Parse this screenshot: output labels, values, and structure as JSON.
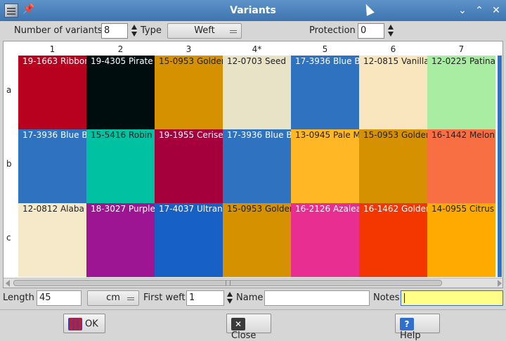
{
  "window": {
    "title": "Variants"
  },
  "toolbar": {
    "num_variants_label": "Number of variants",
    "num_variants_value": "8",
    "type_label": "Type",
    "type_value": "Weft",
    "protection_label": "Protection",
    "protection_value": "0"
  },
  "grid": {
    "columns": [
      "1",
      "2",
      "3",
      "4*",
      "5",
      "6",
      "7"
    ],
    "rows": [
      "a",
      "b",
      "c"
    ],
    "cells": [
      [
        {
          "text": "19-1663 Ribbon",
          "bg": "#b8001f",
          "fg": "#ffffff"
        },
        {
          "text": "19-4305 Pirate",
          "bg": "#000d0f",
          "fg": "#ffffff"
        },
        {
          "text": "15-0953 Golden",
          "bg": "#d69100",
          "fg": "#222222"
        },
        {
          "text": "12-0703 Seed",
          "bg": "#e8e2c6",
          "fg": "#222222"
        },
        {
          "text": "17-3936 Blue B",
          "bg": "#2e72c0",
          "fg": "#ffffff"
        },
        {
          "text": "12-0815 Vanilla",
          "bg": "#f9e6bf",
          "fg": "#222222"
        },
        {
          "text": "12-0225 Patina",
          "bg": "#a8eda2",
          "fg": "#222222"
        }
      ],
      [
        {
          "text": "17-3936 Blue B",
          "bg": "#2e72c0",
          "fg": "#ffffff"
        },
        {
          "text": "15-5416 Robin",
          "bg": "#00c1a2",
          "fg": "#222222"
        },
        {
          "text": "19-1955 Cerise",
          "bg": "#a6003c",
          "fg": "#ffffff"
        },
        {
          "text": "17-3936 Blue B",
          "bg": "#2e72c0",
          "fg": "#ffffff"
        },
        {
          "text": "13-0945 Pale M",
          "bg": "#ffb726",
          "fg": "#222222"
        },
        {
          "text": "15-0953 Golden",
          "bg": "#d69100",
          "fg": "#222222"
        },
        {
          "text": "16-1442 Melon",
          "bg": "#f76f43",
          "fg": "#222222"
        }
      ],
      [
        {
          "text": "12-0812 Alaba",
          "bg": "#f6e9c9",
          "fg": "#222222"
        },
        {
          "text": "18-3027 Purple",
          "bg": "#9d1593",
          "fg": "#ffffff"
        },
        {
          "text": "17-4037 Ultran",
          "bg": "#1760c6",
          "fg": "#ffffff"
        },
        {
          "text": "15-0953 Golden",
          "bg": "#d69100",
          "fg": "#222222"
        },
        {
          "text": "16-2126 Azalea",
          "bg": "#e92e91",
          "fg": "#ffffff"
        },
        {
          "text": "16-1462 Golden",
          "bg": "#f43600",
          "fg": "#ffffff"
        },
        {
          "text": "14-0955 Citrus",
          "bg": "#ffaa00",
          "fg": "#222222"
        }
      ]
    ]
  },
  "bottom": {
    "length_label": "Length",
    "length_value": "45",
    "unit_value": "cm",
    "first_weft_label": "First weft",
    "first_weft_value": "1",
    "name_label": "Name",
    "name_value": "",
    "notes_label": "Notes",
    "notes_value": ""
  },
  "buttons": {
    "ok_label": "OK",
    "close_label": "Close",
    "help_label": "Help"
  },
  "colors": {
    "titlebar": "#4a82be",
    "notes_bg": "#ffff88",
    "notes_border": "#3a6ed6"
  }
}
